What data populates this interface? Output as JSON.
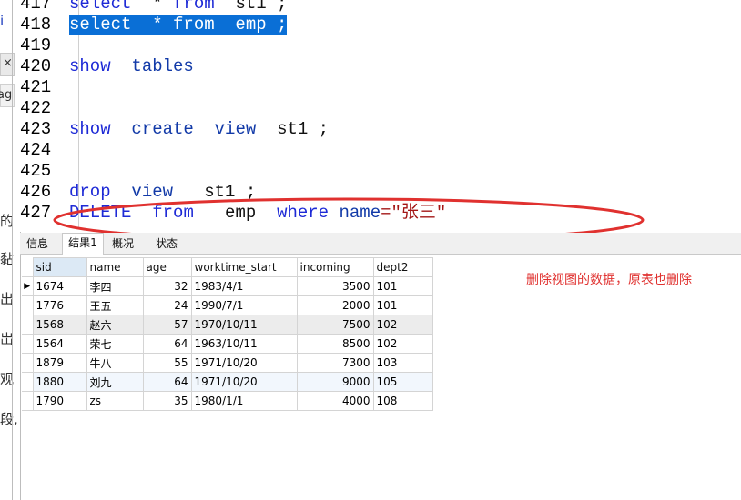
{
  "editor": {
    "lines": [
      {
        "n": "417",
        "tokens": [
          {
            "t": "select",
            "c": "kw"
          },
          {
            "t": "  * ",
            "c": "pl"
          },
          {
            "t": "from",
            "c": "kw"
          },
          {
            "t": "  st1 ;",
            "c": "pl"
          }
        ]
      },
      {
        "n": "418",
        "tokens": [
          {
            "t": "select  * from  emp ;",
            "c": "sel"
          }
        ]
      },
      {
        "n": "419",
        "tokens": []
      },
      {
        "n": "420",
        "tokens": [
          {
            "t": "show",
            "c": "kw"
          },
          {
            "t": "  ",
            "c": "pl"
          },
          {
            "t": "tables",
            "c": "kw2"
          }
        ]
      },
      {
        "n": "421",
        "tokens": []
      },
      {
        "n": "422",
        "tokens": []
      },
      {
        "n": "423",
        "tokens": [
          {
            "t": "show",
            "c": "kw"
          },
          {
            "t": "  ",
            "c": "pl"
          },
          {
            "t": "create",
            "c": "kw2"
          },
          {
            "t": "  ",
            "c": "pl"
          },
          {
            "t": "view",
            "c": "kw2"
          },
          {
            "t": "  st1 ;",
            "c": "pl"
          }
        ]
      },
      {
        "n": "424",
        "tokens": []
      },
      {
        "n": "425",
        "tokens": []
      },
      {
        "n": "426",
        "tokens": [
          {
            "t": "drop",
            "c": "kw"
          },
          {
            "t": "  ",
            "c": "pl"
          },
          {
            "t": "view",
            "c": "kw2"
          },
          {
            "t": "   st1 ;",
            "c": "pl"
          }
        ]
      },
      {
        "n": "427",
        "tokens": [
          {
            "t": "DELETE",
            "c": "kw"
          },
          {
            "t": "  ",
            "c": "pl"
          },
          {
            "t": "from",
            "c": "kw"
          },
          {
            "t": "   emp  ",
            "c": "pl"
          },
          {
            "t": "where",
            "c": "kw"
          },
          {
            "t": " ",
            "c": "pl"
          },
          {
            "t": "name",
            "c": "kw2"
          },
          {
            "t": "=\"张三\"",
            "c": "str"
          }
        ]
      }
    ]
  },
  "left_fragments": [
    "i",
    "×",
    "ag",
    "的",
    "黏",
    "出",
    "岀",
    "观",
    "段,"
  ],
  "tabs": [
    {
      "label": "信息"
    },
    {
      "label": "结果1"
    },
    {
      "label": "概况"
    },
    {
      "label": "状态"
    }
  ],
  "result": {
    "columns": [
      "sid",
      "name",
      "age",
      "worktime_start",
      "incoming",
      "dept2"
    ],
    "rows": [
      [
        "1674",
        "李四",
        "32",
        "1983/4/1",
        "3500",
        "101"
      ],
      [
        "1776",
        "王五",
        "24",
        "1990/7/1",
        "2000",
        "101"
      ],
      [
        "1568",
        "赵六",
        "57",
        "1970/10/11",
        "7500",
        "102"
      ],
      [
        "1564",
        "荣七",
        "64",
        "1963/10/11",
        "8500",
        "102"
      ],
      [
        "1879",
        "牛八",
        "55",
        "1971/10/20",
        "7300",
        "103"
      ],
      [
        "1880",
        "刘九",
        "64",
        "1971/10/20",
        "9000",
        "105"
      ],
      [
        "1790",
        "zs",
        "35",
        "1980/1/1",
        "4000",
        "108"
      ]
    ]
  },
  "note": "删除视图的数据，原表也删除",
  "colors": {
    "keyword": "#1e2ad6",
    "selection": "#0a6fd6",
    "annotation": "#e0312f",
    "string": "#a31515"
  }
}
